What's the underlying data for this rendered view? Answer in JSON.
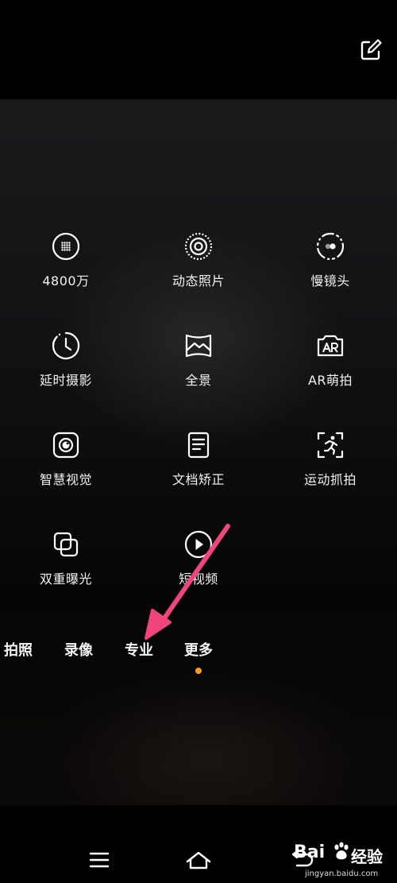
{
  "modes": [
    {
      "label": "4800万",
      "icon": "grid-dots-icon"
    },
    {
      "label": "动态照片",
      "icon": "live-photo-icon"
    },
    {
      "label": "慢镜头",
      "icon": "slow-motion-icon"
    },
    {
      "label": "延时摄影",
      "icon": "timelapse-icon"
    },
    {
      "label": "全景",
      "icon": "panorama-icon"
    },
    {
      "label": "AR萌拍",
      "icon": "ar-camera-icon"
    },
    {
      "label": "智慧视觉",
      "icon": "smart-vision-icon"
    },
    {
      "label": "文档矫正",
      "icon": "document-icon"
    },
    {
      "label": "运动抓拍",
      "icon": "running-person-icon"
    },
    {
      "label": "双重曝光",
      "icon": "double-exposure-icon"
    },
    {
      "label": "短视频",
      "icon": "short-video-play-icon"
    }
  ],
  "tabs": [
    {
      "label": "拍照"
    },
    {
      "label": "录像"
    },
    {
      "label": "专业"
    },
    {
      "label": "更多",
      "selected": true
    }
  ],
  "accent_color": "#ff9a1f",
  "annotation_arrow_color": "#f0457a",
  "navbar": {
    "buttons": [
      "menu-icon",
      "home-icon",
      "back-icon"
    ]
  },
  "watermark": {
    "brand": "Bai",
    "brand_suffix": "经验",
    "url": "jingyan.baidu.com"
  }
}
